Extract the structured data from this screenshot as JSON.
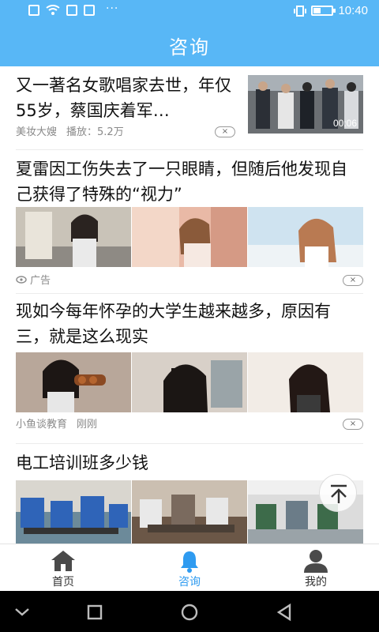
{
  "status_bar": {
    "time": "10:40",
    "dots": "···"
  },
  "header": {
    "title": "咨询"
  },
  "feed": [
    {
      "title": "又一著名女歌唱家去世，年仅55岁，蔡国庆着军…",
      "source": "美妆大嫂",
      "plays": "播放：5.2万",
      "duration": "00:06",
      "close": "×"
    },
    {
      "title": "夏雷因工伤失去了一只眼睛，但随后他发现自己获得了特殊的“视力”",
      "ad_label": "广告",
      "close": "×"
    },
    {
      "title": "现如今每年怀孕的大学生越来越多，原因有三，就是这么现实",
      "source": "小鱼谈教育",
      "time": "刚刚",
      "close": "×"
    },
    {
      "title": "电工培训班多少钱"
    }
  ],
  "bottom_nav": [
    {
      "label": "首页",
      "icon": "home-icon",
      "active": false
    },
    {
      "label": "咨询",
      "icon": "bell-icon",
      "active": true
    },
    {
      "label": "我的",
      "icon": "user-icon",
      "active": false
    }
  ],
  "colors": {
    "brand": "#58b7f6",
    "active": "#2f9bf0",
    "inactive": "#333333"
  }
}
